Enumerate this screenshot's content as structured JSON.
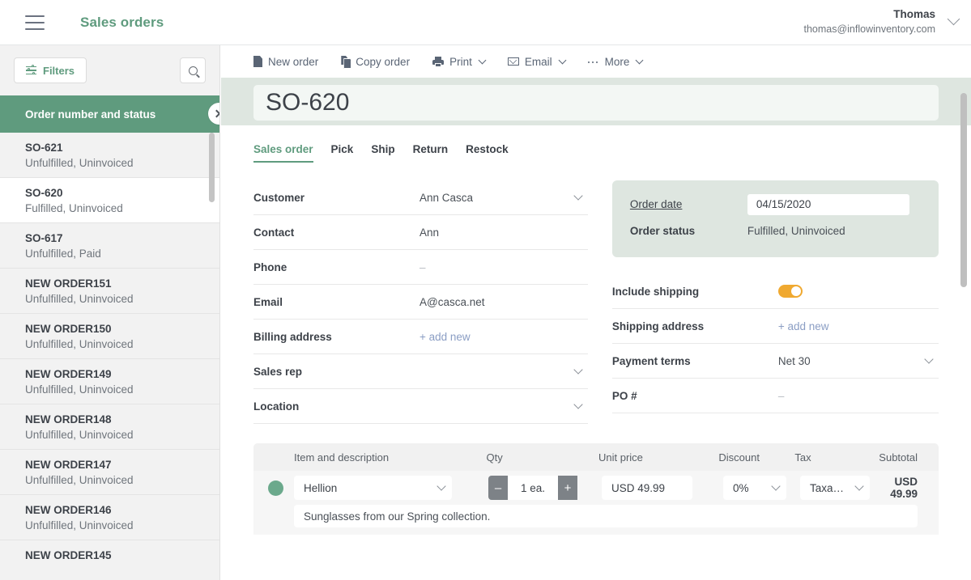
{
  "topbar": {
    "menu_icon": "hamburger-icon",
    "app_title": "Sales orders",
    "user_name": "Thomas",
    "user_email": "thomas@inflowinventory.com",
    "user_caret_icon": "chevron-down-icon"
  },
  "sidebar": {
    "filters_label": "Filters",
    "filters_icon": "filter-icon",
    "search_icon": "search-icon",
    "collapse_icon": "collapse-panel-icon",
    "list_header": "Order number and status",
    "orders": [
      {
        "number": "SO-621",
        "status": "Unfulfilled, Uninvoiced",
        "selected": false
      },
      {
        "number": "SO-620",
        "status": "Fulfilled, Uninvoiced",
        "selected": true
      },
      {
        "number": "SO-617",
        "status": "Unfulfilled, Paid",
        "selected": false
      },
      {
        "number": "NEW ORDER151",
        "status": "Unfulfilled, Uninvoiced",
        "selected": false
      },
      {
        "number": "NEW ORDER150",
        "status": "Unfulfilled, Uninvoiced",
        "selected": false
      },
      {
        "number": "NEW ORDER149",
        "status": "Unfulfilled, Uninvoiced",
        "selected": false
      },
      {
        "number": "NEW ORDER148",
        "status": "Unfulfilled, Uninvoiced",
        "selected": false
      },
      {
        "number": "NEW ORDER147",
        "status": "Unfulfilled, Uninvoiced",
        "selected": false
      },
      {
        "number": "NEW ORDER146",
        "status": "Unfulfilled, Uninvoiced",
        "selected": false
      },
      {
        "number": "NEW ORDER145",
        "status": "",
        "selected": false
      }
    ]
  },
  "toolbar": {
    "new_order": "New order",
    "copy_order": "Copy order",
    "print": "Print",
    "email": "Email",
    "more": "More"
  },
  "order": {
    "title": "SO-620",
    "tabs": [
      {
        "label": "Sales order",
        "active": true
      },
      {
        "label": "Pick",
        "active": false
      },
      {
        "label": "Ship",
        "active": false
      },
      {
        "label": "Return",
        "active": false
      },
      {
        "label": "Restock",
        "active": false
      }
    ],
    "left_fields": [
      {
        "label": "Customer",
        "value": "Ann Casca",
        "caret": true,
        "style": ""
      },
      {
        "label": "Contact",
        "value": "Ann",
        "caret": false,
        "style": ""
      },
      {
        "label": "Phone",
        "value": "–",
        "caret": false,
        "style": "muted"
      },
      {
        "label": "Email",
        "value": "A@casca.net",
        "caret": false,
        "style": ""
      },
      {
        "label": "Billing address",
        "value": "+ add new",
        "caret": false,
        "style": "link"
      },
      {
        "label": "Sales rep",
        "value": "",
        "caret": true,
        "style": ""
      },
      {
        "label": "Location",
        "value": "",
        "caret": true,
        "style": ""
      }
    ],
    "status_box": {
      "order_date_label": "Order date",
      "order_date_value": "04/15/2020",
      "order_status_label": "Order status",
      "order_status_value": "Fulfilled, Uninvoiced"
    },
    "right_fields": [
      {
        "label": "Include shipping",
        "value": "",
        "caret": false,
        "style": "",
        "toggle": true,
        "toggle_on": true
      },
      {
        "label": "Shipping address",
        "value": "+ add new",
        "caret": false,
        "style": "link",
        "toggle": false
      },
      {
        "label": "Payment terms",
        "value": "Net 30",
        "caret": true,
        "style": "",
        "toggle": false
      },
      {
        "label": "PO #",
        "value": "–",
        "caret": false,
        "style": "muted",
        "toggle": false
      }
    ],
    "items_table": {
      "headers": {
        "item": "Item and description",
        "qty": "Qty",
        "unit_price": "Unit price",
        "discount": "Discount",
        "tax": "Tax",
        "subtotal": "Subtotal"
      },
      "rows": [
        {
          "item": "Hellion",
          "qty": "1 ea.",
          "minus": "–",
          "plus": "+",
          "unit_price": "USD 49.99",
          "discount": "0%",
          "tax": "Taxa…",
          "subtotal": "USD 49.99",
          "description": "Sunglasses from our Spring collection."
        }
      ]
    }
  },
  "colors": {
    "brand_green": "#5f9b7e",
    "header_band": "#dee6e0",
    "toggle_on": "#f0a930",
    "item_dot": "#6ba98c"
  }
}
